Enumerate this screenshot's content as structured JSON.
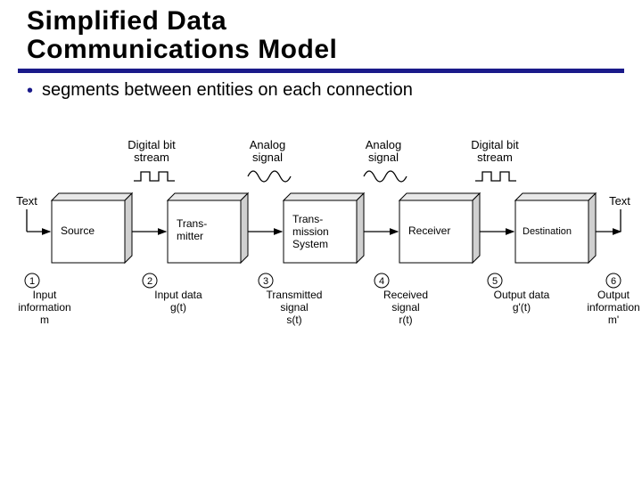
{
  "title_line1": "Simplified Data",
  "title_line2": "Communications Model",
  "bullet": "segments between entities on each connection",
  "top_labels": {
    "l1a": "Digital bit",
    "l1b": "stream",
    "l2a": "Analog",
    "l2b": "signal",
    "l3a": "Analog",
    "l3b": "signal",
    "l4a": "Digital bit",
    "l4b": "stream"
  },
  "side_left": "Text",
  "side_right": "Text",
  "boxes": {
    "b1": "Source",
    "b2a": "Trans-",
    "b2b": "mitter",
    "b3a": "Trans-",
    "b3b": "mission",
    "b3c": "System",
    "b4": "Receiver",
    "b5": "Destination"
  },
  "nums": {
    "n1": "1",
    "n2": "2",
    "n3": "3",
    "n4": "4",
    "n5": "5",
    "n6": "6"
  },
  "bottoms": {
    "c1a": "Input",
    "c1b": "information",
    "c1c": "m",
    "c2a": "Input data",
    "c2b": "g(t)",
    "c3a": "Transmitted",
    "c3b": "signal",
    "c3c": "s(t)",
    "c4a": "Received",
    "c4b": "signal",
    "c4c": "r(t)",
    "c5a": "Output data",
    "c5b": "g'(t)",
    "c6a": "Output",
    "c6b": "information",
    "c6c": "m'"
  }
}
